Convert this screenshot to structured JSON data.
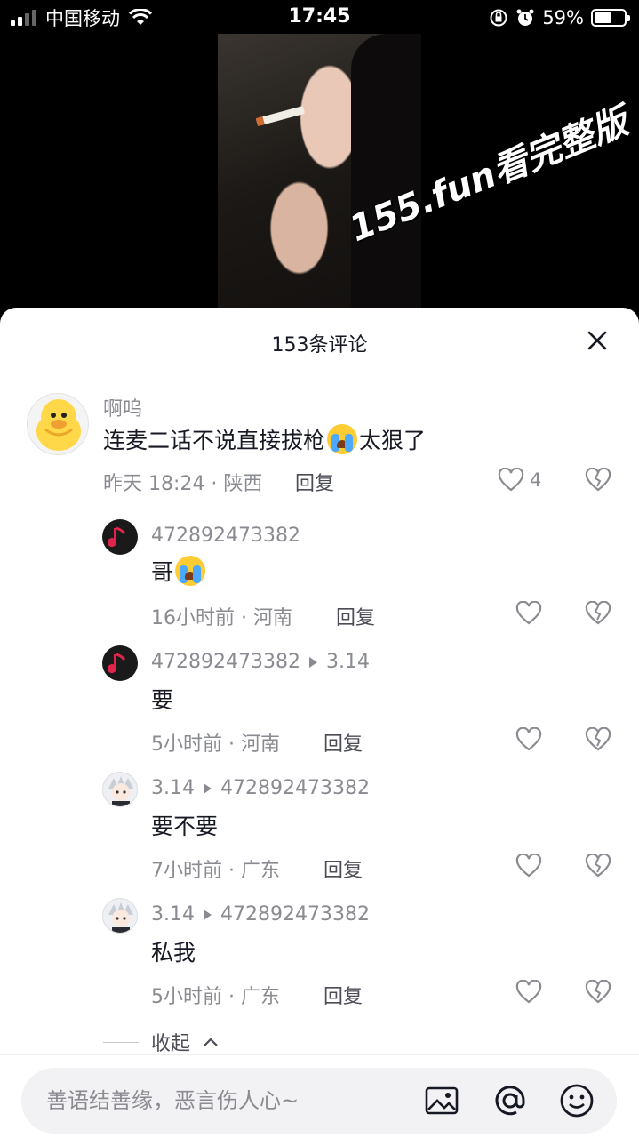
{
  "status_bar": {
    "carrier": "中国移动",
    "time": "17:45",
    "battery": "59%",
    "battery_level": 0.59
  },
  "video": {
    "watermark": "155.fun看完整版"
  },
  "sheet": {
    "title": "153条评论",
    "collapse_label": "收起"
  },
  "comments": [
    {
      "user": "啊呜",
      "text_before": "连麦二话不说直接拔枪",
      "text_after": "太狠了",
      "meta": "昨天 18:24 · 陕西",
      "reply": "回复",
      "likes": "4"
    },
    {
      "user": "472892473382",
      "text_before": "哥",
      "meta": "16小时前 · 河南",
      "reply": "回复"
    },
    {
      "user": "472892473382",
      "reply_to": "3.14",
      "text": "要",
      "meta": "5小时前 · 河南",
      "reply": "回复"
    },
    {
      "user": "3.14",
      "reply_to": "472892473382",
      "text": "要不要",
      "meta": "7小时前 · 广东",
      "reply": "回复"
    },
    {
      "user": "3.14",
      "reply_to": "472892473382",
      "text": "私我",
      "meta": "5小时前 · 广东",
      "reply": "回复"
    }
  ],
  "input": {
    "placeholder": "善语结善缘，恶言伤人心~"
  },
  "colors": {
    "sheet_bg": "#ffffff",
    "secondary_text": "#8a8b91",
    "primary_text": "#161823"
  }
}
